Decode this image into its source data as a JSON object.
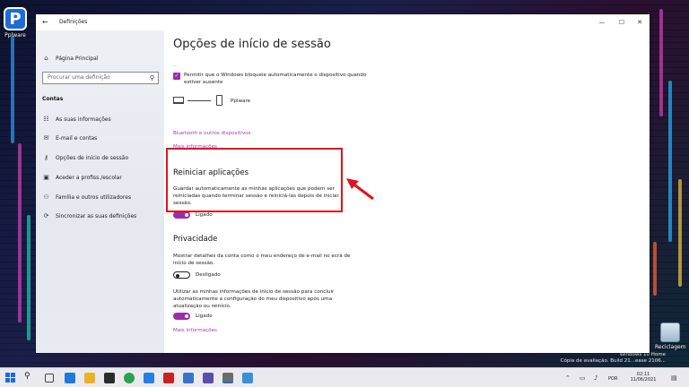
{
  "desktop": {
    "icons": [
      {
        "label": "Pplware"
      },
      {
        "label": "Reciclagem"
      }
    ],
    "watermark": {
      "line1": "Windows 10 Home",
      "line2": "Cópia de avaliação. Build 21...ease 2106..."
    }
  },
  "window": {
    "title": "Definições",
    "controls": {
      "minimize": "—",
      "maximize": "☐",
      "close": "✕"
    }
  },
  "sidebar": {
    "home_label": "Página Principal",
    "search_placeholder": "Procurar uma definição",
    "section_label": "Contas",
    "items": [
      {
        "label": "As suas informações",
        "icon": "person-card-icon"
      },
      {
        "label": "E-mail e contas",
        "icon": "mail-icon"
      },
      {
        "label": "Opções de início de sessão",
        "icon": "key-icon"
      },
      {
        "label": "Aceder a profiss./escolar",
        "icon": "briefcase-icon"
      },
      {
        "label": "Família e outros utilizadores",
        "icon": "people-icon"
      },
      {
        "label": "Sincronizar as suas definições",
        "icon": "sync-icon"
      }
    ]
  },
  "content": {
    "page_title": "Opções de início de sessão",
    "cut_text": "...",
    "dynamic_lock": {
      "checkbox_label": "Permitir que o Windows bloqueie automaticamente o dispositivo quando estiver ausente",
      "device_name": "Pplware",
      "bluetooth_link": "Bluetooth e outros dispositivos",
      "more_info_link": "Mais informações"
    },
    "restart_apps": {
      "title": "Reiniciar aplicações",
      "description": "Guardar automaticamente as minhas aplicações que podem ser reiniciadas quando terminar sessão e reiniciá-las depois de iniciar sessão.",
      "toggle_state": "Ligado"
    },
    "privacy": {
      "title": "Privacidade",
      "account_details_text": "Mostrar detalhes da conta como o meu endereço de e-mail no ecrã de início de sessão.",
      "account_details_state": "Desligado",
      "signin_info_text": "Utilizar as minhas informações de início de sessão para concluir automaticamente a configuração do meu dispositivo após uma atualização ou reinício.",
      "signin_info_state": "Ligado",
      "more_info_link": "Mais informações"
    }
  },
  "taskbar": {
    "language": "POR",
    "time": "02:11",
    "date": "11/06/2021"
  },
  "colors": {
    "accent": "#9a2ea8",
    "highlight": "#e0141e"
  }
}
